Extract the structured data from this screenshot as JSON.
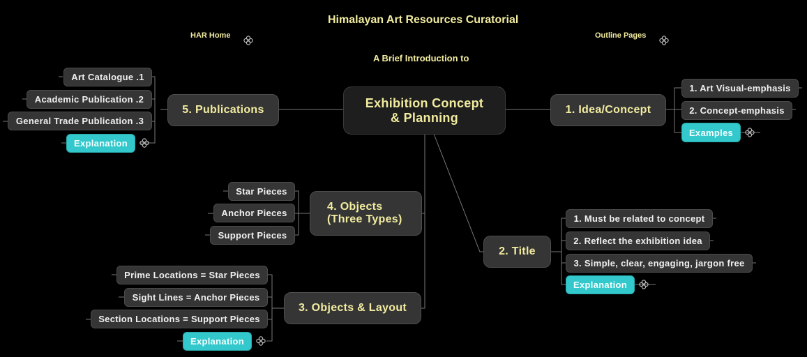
{
  "header": {
    "title": "Himalayan Art Resources Curatorial",
    "subtitle": "A Brief Introduction to",
    "links": [
      {
        "label": "HAR Home",
        "icon": "link-icon"
      },
      {
        "label": "Outline Pages",
        "icon": "link-icon"
      }
    ]
  },
  "colors": {
    "background": "#000000",
    "node_fill": "#353535",
    "main_text": "#f2eca0",
    "sub_text": "#f0f0f0",
    "accent": "#33c8cc",
    "connector": "#777777"
  },
  "center": {
    "line1": "Exhibition Concept",
    "line2": "& Planning"
  },
  "branches": {
    "idea": {
      "label": "1. Idea/Concept",
      "children": [
        "1. Art Visual-emphasis",
        "2. Concept-emphasis"
      ],
      "link": {
        "label": "Examples",
        "icon": "link-icon"
      }
    },
    "title": {
      "label": "2. Title",
      "children": [
        "1. Must be related to concept",
        "2. Reflect the exhibition idea",
        "3. Simple, clear, engaging, jargon free"
      ],
      "link": {
        "label": "Explanation",
        "icon": "link-icon"
      }
    },
    "layout": {
      "label": "3. Objects & Layout",
      "children": [
        "Prime Locations = Star Pieces",
        "Sight Lines = Anchor Pieces",
        "Section Locations = Support Pieces"
      ],
      "link": {
        "label": "Explanation",
        "icon": "link-icon"
      }
    },
    "objects": {
      "line1": "4. Objects",
      "line2": "(Three Types)",
      "children": [
        "Star Pieces",
        "Anchor Pieces",
        "Support Pieces"
      ]
    },
    "publications": {
      "label": "5. Publications",
      "children": [
        "Art Catalogue .1",
        "Academic Publication .2",
        "General Trade Publication .3"
      ],
      "link": {
        "label": "Explanation",
        "icon": "link-icon"
      }
    }
  }
}
